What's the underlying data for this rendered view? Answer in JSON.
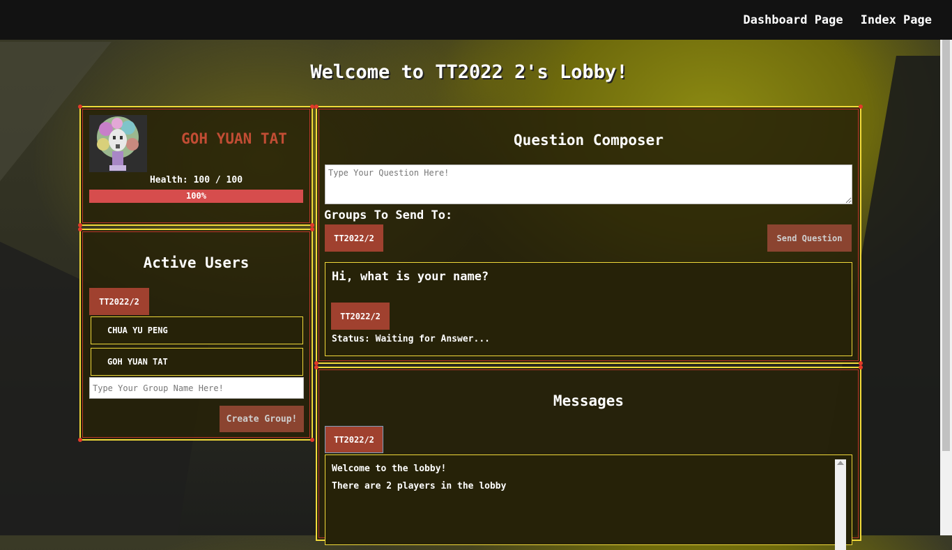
{
  "nav": {
    "dashboard_label": "Dashboard Page",
    "index_label": "Index Page"
  },
  "lobby": {
    "title": "Welcome to TT2022 2's Lobby!"
  },
  "profile": {
    "name": "GOH YUAN TAT",
    "health_label": "Health: 100 / 100",
    "health_percent": 100,
    "health_percent_label": "100%"
  },
  "active_users": {
    "title": "Active Users",
    "group_tag": "TT2022/2",
    "users": [
      "CHUA YU PENG",
      "GOH YUAN TAT"
    ],
    "group_name_placeholder": "Type Your Group Name Here!",
    "create_button": "Create Group!"
  },
  "composer": {
    "title": "Question Composer",
    "question_placeholder": "Type Your Question Here!",
    "groups_label": "Groups To Send To:",
    "group_tag": "TT2022/2",
    "send_button": "Send Question",
    "question": {
      "text": "Hi, what is your name?",
      "group_tag": "TT2022/2",
      "status": "Status: Waiting for Answer..."
    }
  },
  "messages": {
    "title": "Messages",
    "group_tag": "TT2022/2",
    "lines": [
      "Welcome to the lobby!",
      "There are 2 players in the lobby"
    ]
  },
  "colors": {
    "accent_border": "#f1da3a",
    "button": "#a0412f",
    "player_name": "#c24d34",
    "health": "#d64d4d"
  }
}
